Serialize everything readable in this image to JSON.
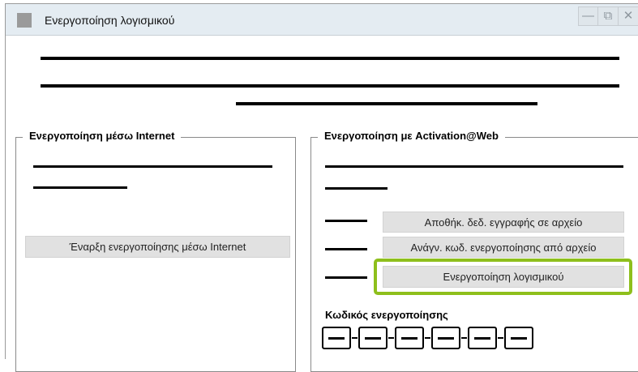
{
  "window": {
    "title": "Ενεργοποίηση λογισμικού",
    "controls": {
      "minimize": "—",
      "restore": "⧉",
      "close": "✕"
    },
    "accent": "#8ebf1c"
  },
  "internet_group": {
    "legend": "Ενεργοποίηση μέσω Internet",
    "start_button": "Έναρξη ενεργοποίησης μέσω Internet"
  },
  "web_group": {
    "legend": "Ενεργοποίηση με Activation@Web",
    "save_button": "Αποθήκ. δεδ. εγγραφής σε αρχείο",
    "read_button": "Ανάγν. κωδ. ενεργοποίησης από αρχείο",
    "activate_button": "Ενεργοποίηση λογισμικού",
    "code_label": "Κωδικός ενεργοποίησης"
  }
}
